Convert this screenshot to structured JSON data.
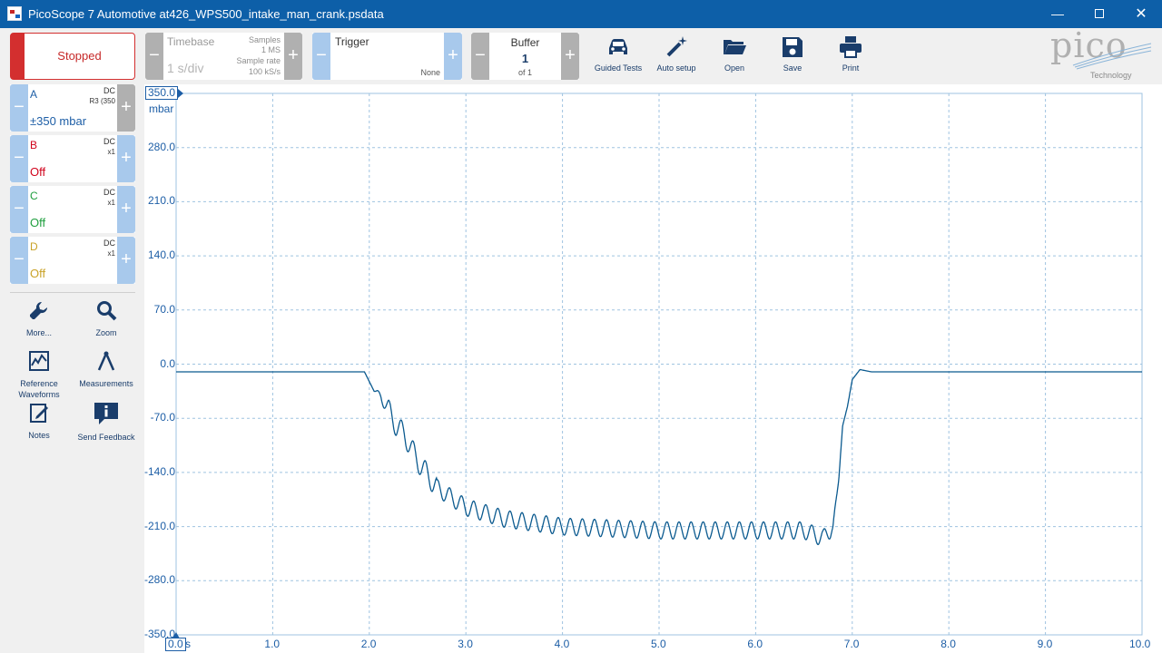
{
  "window": {
    "title": "PicoScope 7 Automotive at426_WPS500_intake_man_crank.psdata"
  },
  "toolbar": {
    "run_status": "Stopped",
    "timebase": {
      "label": "Timebase",
      "value": "1 s/div",
      "samples_label": "Samples",
      "samples_value": "1 MS",
      "rate_label": "Sample rate",
      "rate_value": "100 kS/s"
    },
    "trigger": {
      "label": "Trigger",
      "mode": "None"
    },
    "buffer": {
      "label": "Buffer",
      "index": "1",
      "of": "of 1"
    },
    "tools": [
      {
        "label": "Guided Tests",
        "icon": "car-icon"
      },
      {
        "label": "Auto setup",
        "icon": "wand-icon"
      },
      {
        "label": "Open",
        "icon": "folder-icon"
      },
      {
        "label": "Save",
        "icon": "floppy-icon"
      },
      {
        "label": "Print",
        "icon": "printer-icon"
      }
    ],
    "logo": {
      "word": "pico",
      "sub": "Technology"
    }
  },
  "channels": [
    {
      "name": "A",
      "coupling": "DC",
      "probe": "R3 (350",
      "value": "±350 mbar",
      "color": "#1d5ea6"
    },
    {
      "name": "B",
      "coupling": "DC",
      "probe": "x1",
      "value": "Off",
      "color": "#d0021b"
    },
    {
      "name": "C",
      "coupling": "DC",
      "probe": "x1",
      "value": "Off",
      "color": "#1e9e3e"
    },
    {
      "name": "D",
      "coupling": "DC",
      "probe": "x1",
      "value": "Off",
      "color": "#c9a227"
    }
  ],
  "side_tools": [
    {
      "label": "More...",
      "icon": "wrench-icon"
    },
    {
      "label": "Zoom",
      "icon": "magnifier-icon"
    },
    {
      "label": "Reference Waveforms",
      "icon": "reference-waveform-icon"
    },
    {
      "label": "Measurements",
      "icon": "calipers-icon"
    },
    {
      "label": "Notes",
      "icon": "notes-icon"
    },
    {
      "label": "Send Feedback",
      "icon": "feedback-icon"
    }
  ],
  "chart_data": {
    "type": "line",
    "title": "",
    "xlabel": "s",
    "ylabel": "mbar",
    "xlim": [
      0,
      10
    ],
    "ylim": [
      -350,
      350
    ],
    "grid": true,
    "x_ticks": [
      "0.0",
      "1.0",
      "2.0",
      "3.0",
      "4.0",
      "5.0",
      "6.0",
      "7.0",
      "8.0",
      "9.0",
      "10.0"
    ],
    "y_ticks": [
      "350.0",
      "280.0",
      "210.0",
      "140.0",
      "70.0",
      "0.0",
      "-70.0",
      "-140.0",
      "-210.0",
      "-280.0",
      "-350.0"
    ],
    "series": [
      {
        "color": "#0b5a8f",
        "x": [
          0,
          1.95,
          2.05,
          2.12,
          2.2,
          2.28,
          2.36,
          2.5,
          2.7,
          3.0,
          3.4,
          4.0,
          5.0,
          6.0,
          6.5,
          6.7,
          6.8,
          6.86,
          6.9,
          6.95,
          7.0,
          7.08,
          7.2,
          10.0
        ],
        "y": [
          -10,
          -10,
          -35,
          -40,
          -60,
          -80,
          -90,
          -125,
          -160,
          -185,
          -200,
          -210,
          -215,
          -215,
          -215,
          -225,
          -210,
          -150,
          -80,
          -55,
          -20,
          -7,
          -10,
          -10
        ]
      }
    ]
  }
}
